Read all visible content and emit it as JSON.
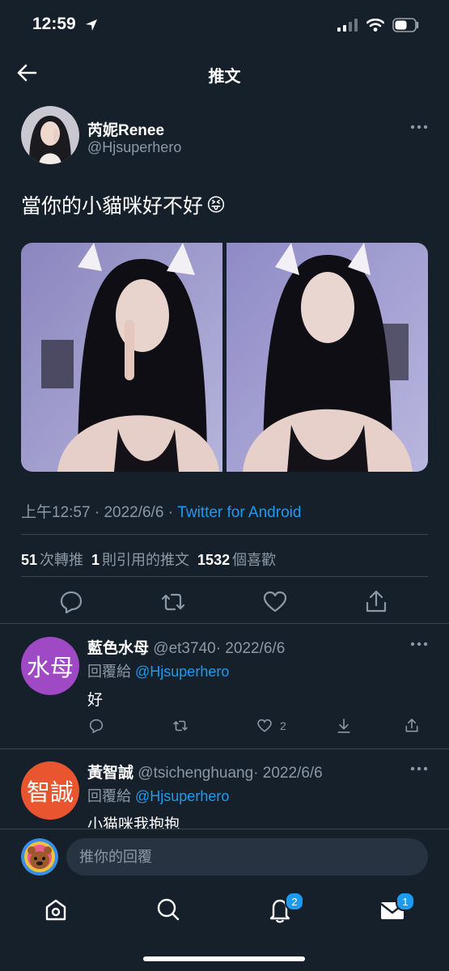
{
  "status_bar": {
    "time": "12:59",
    "icons": [
      "location-arrow-icon",
      "cellular-icon",
      "wifi-icon",
      "battery-icon"
    ]
  },
  "header": {
    "title": "推文",
    "back_icon": "back-arrow-icon"
  },
  "tweet": {
    "author_name": "芮妮Renee",
    "author_handle": "@Hjsuperhero",
    "text": "當你的小貓咪好不好",
    "emoji": "😝",
    "time": "上午12:57",
    "date": "2022/6/6",
    "source": "Twitter for Android",
    "sep": "·",
    "stats": {
      "retweets": "51",
      "retweets_label": "次轉推",
      "quotes": "1",
      "quotes_label": "則引用的推文",
      "likes": "1532",
      "likes_label": "個喜歡"
    }
  },
  "replies": [
    {
      "avatar_text": "水母",
      "avatar_color": "#a049c4",
      "name": "藍色水母",
      "handle": "@et3740",
      "date": "· 2022/6/6",
      "replying_label": "回覆給",
      "replying_to": "@Hjsuperhero",
      "text": "好",
      "like_count": "2"
    },
    {
      "avatar_text": "智誠",
      "avatar_color": "#e8552f",
      "name": "黃智誠",
      "handle": "@tsichenghuang",
      "date": "· 2022/6/6",
      "replying_label": "回覆給",
      "replying_to": "@Hjsuperhero",
      "text": "小猫咪我抱抱"
    }
  ],
  "compose": {
    "placeholder": "推你的回覆"
  },
  "tab_bar": {
    "items": [
      "home-icon",
      "search-icon",
      "notifications-icon",
      "messages-icon"
    ],
    "notifications_badge": "2",
    "messages_badge": "1"
  },
  "colors": {
    "background": "#15202b",
    "accent": "#1d9bf0",
    "muted": "#8b98a5",
    "divider": "#38444d"
  }
}
